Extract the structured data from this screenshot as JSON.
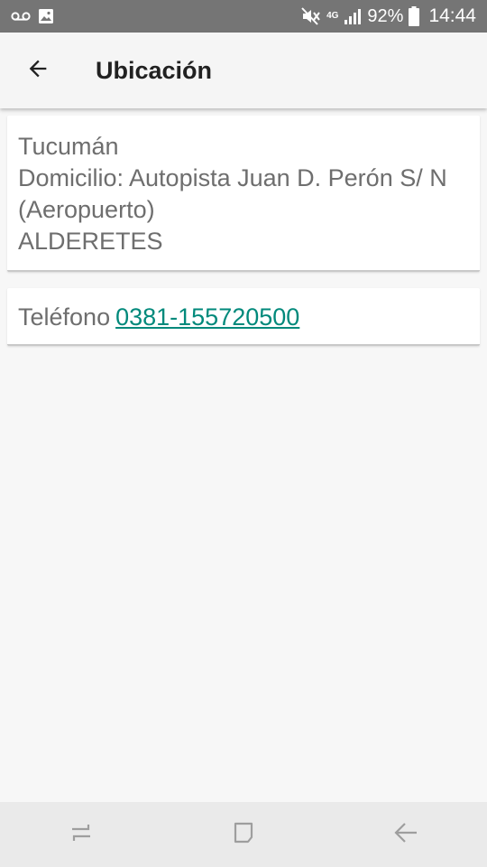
{
  "status_bar": {
    "network_label": "4G",
    "battery_percent": "92%",
    "time": "14:44",
    "icons": [
      "voicemail-icon",
      "image-icon",
      "mute-icon",
      "signal-icon",
      "battery-icon"
    ]
  },
  "app_bar": {
    "title": "Ubicación",
    "back_icon": "arrow-back-icon"
  },
  "location_card": {
    "province": "Tucumán",
    "address": "Domicilio: Autopista Juan D. Perón S/ N (Aeropuerto)",
    "city": "ALDERETES"
  },
  "phone_card": {
    "label": "Teléfono",
    "number": "0381-155720500"
  },
  "colors": {
    "status_bar": "#757575",
    "app_bar": "#f5f5f5",
    "link": "#00897b",
    "text": "#6e6e6e"
  },
  "nav_bar": {
    "icons": [
      "recents-icon",
      "home-icon",
      "back-icon"
    ]
  }
}
